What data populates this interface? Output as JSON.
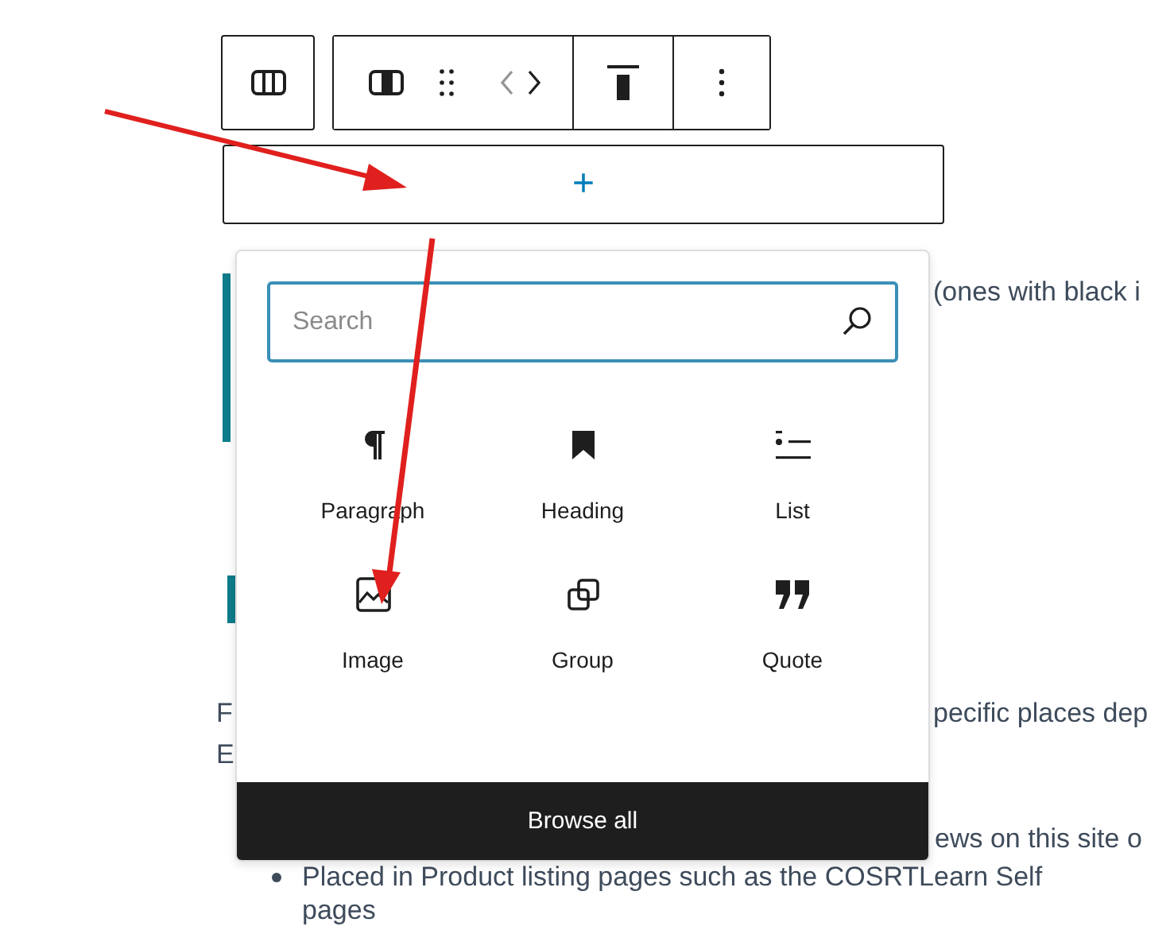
{
  "appender": {
    "label": "+"
  },
  "inserter": {
    "search": {
      "placeholder": "Search"
    },
    "blocks": [
      {
        "kind": "paragraph",
        "label": "Paragraph"
      },
      {
        "kind": "heading",
        "label": "Heading"
      },
      {
        "kind": "list",
        "label": "List"
      },
      {
        "kind": "image",
        "label": "Image"
      },
      {
        "kind": "group",
        "label": "Group"
      },
      {
        "kind": "quote",
        "label": "Quote"
      }
    ],
    "browse_all": "Browse all"
  },
  "lines": [
    {
      "kind": "quote-bar",
      "right": "(ones with black i"
    },
    {
      "kind": "heading-bar"
    },
    {
      "kind": "split",
      "left": "F",
      "right": "pecific places dep"
    },
    {
      "kind": "split",
      "left": "E"
    },
    {
      "kind": "right-wide",
      "right": "ews  on this site o"
    },
    {
      "kind": "bullet",
      "text": "Placed in Product listing pages such as the COSRTLearn Self"
    },
    {
      "kind": "continuation",
      "text": "pages"
    }
  ]
}
